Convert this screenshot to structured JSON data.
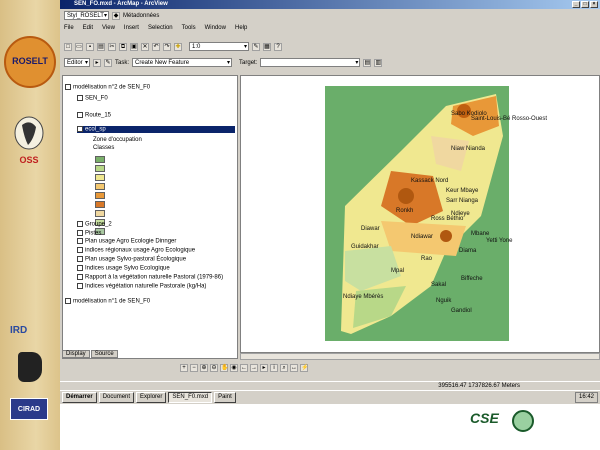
{
  "sidebar": {
    "roselt_text": "ROSELT",
    "oss_text": "OSS",
    "ird_text": "IRD",
    "cirad_text": "CIRAD"
  },
  "window": {
    "title": "SEN_FO.mxd - ArcMap - ArcView"
  },
  "toolbar1": {
    "combo": "Styl_ROSELT",
    "combo2_label": "Métadonnées"
  },
  "menu": {
    "items": [
      "File",
      "Edit",
      "View",
      "Insert",
      "Selection",
      "Tools",
      "Window",
      "Help"
    ]
  },
  "toolbar2": {
    "scale": "1:0"
  },
  "toolbar3": {
    "editor": "Editor",
    "task": "Create New Feature",
    "target": "Target:"
  },
  "toc": {
    "frame1": "modélisation n°2 de SEN_F0",
    "layers": [
      {
        "label": "SEN_F0"
      },
      {
        "label": "Route_15"
      },
      {
        "label": "ecol_sp"
      },
      {
        "label": "Zone d'occupation"
      },
      {
        "label": "Classes"
      },
      {
        "label": "Groupe_2"
      },
      {
        "label": "Pistes"
      },
      {
        "label": "Plan usage Agro Ecologie Dinnger"
      },
      {
        "label": "indices régionaux usage Agro Ecologique"
      },
      {
        "label": "Plan usage Sylvo-pastoral Écologique"
      },
      {
        "label": "Indices usage Sylvo Ecologique"
      },
      {
        "label": "Rapport à la végétation naturelle Pastoral (1979-86)"
      },
      {
        "label": "Indices végétation naturelle Pastorale (kg/Ha)"
      }
    ],
    "legend_swatch_colors": [
      "#7ab06a",
      "#b8d888",
      "#f0e890",
      "#f4c870",
      "#e89838",
      "#d87828",
      "#f0d8a0",
      "#c8e0a0",
      "#a8c8a0"
    ],
    "frame2": "modélisation n°1 de SEN_F0",
    "tabs": [
      "Display",
      "Source"
    ]
  },
  "map": {
    "background": "#6aae6a",
    "labels": [
      "Sabo Kodiolo",
      "Saint-Louis-Bé Rosso-Ouest",
      "Niaw Nianda",
      "Keur Mbaye",
      "Sarr Nianga",
      "Kassack Nord",
      "Ndieye",
      "Ronkh",
      "Ross Béthio",
      "Diawar",
      "Mbane",
      "Yetti Yone",
      "Ndiawar",
      "Guidakhar",
      "Diama",
      "Rao",
      "Mpal",
      "Sakal",
      "Biffeche",
      "Ndiaye Mbérès",
      "Nguik",
      "Gandiol"
    ]
  },
  "status": {
    "coords": "395516.47 1737826.67 Meters"
  },
  "taskbar": {
    "items": [
      "Démarrer",
      "Document",
      "Explorer",
      "SEN_F0.mxd",
      "Paint"
    ],
    "clock": "16:42"
  },
  "footer": {
    "cse_text": "CSE"
  }
}
